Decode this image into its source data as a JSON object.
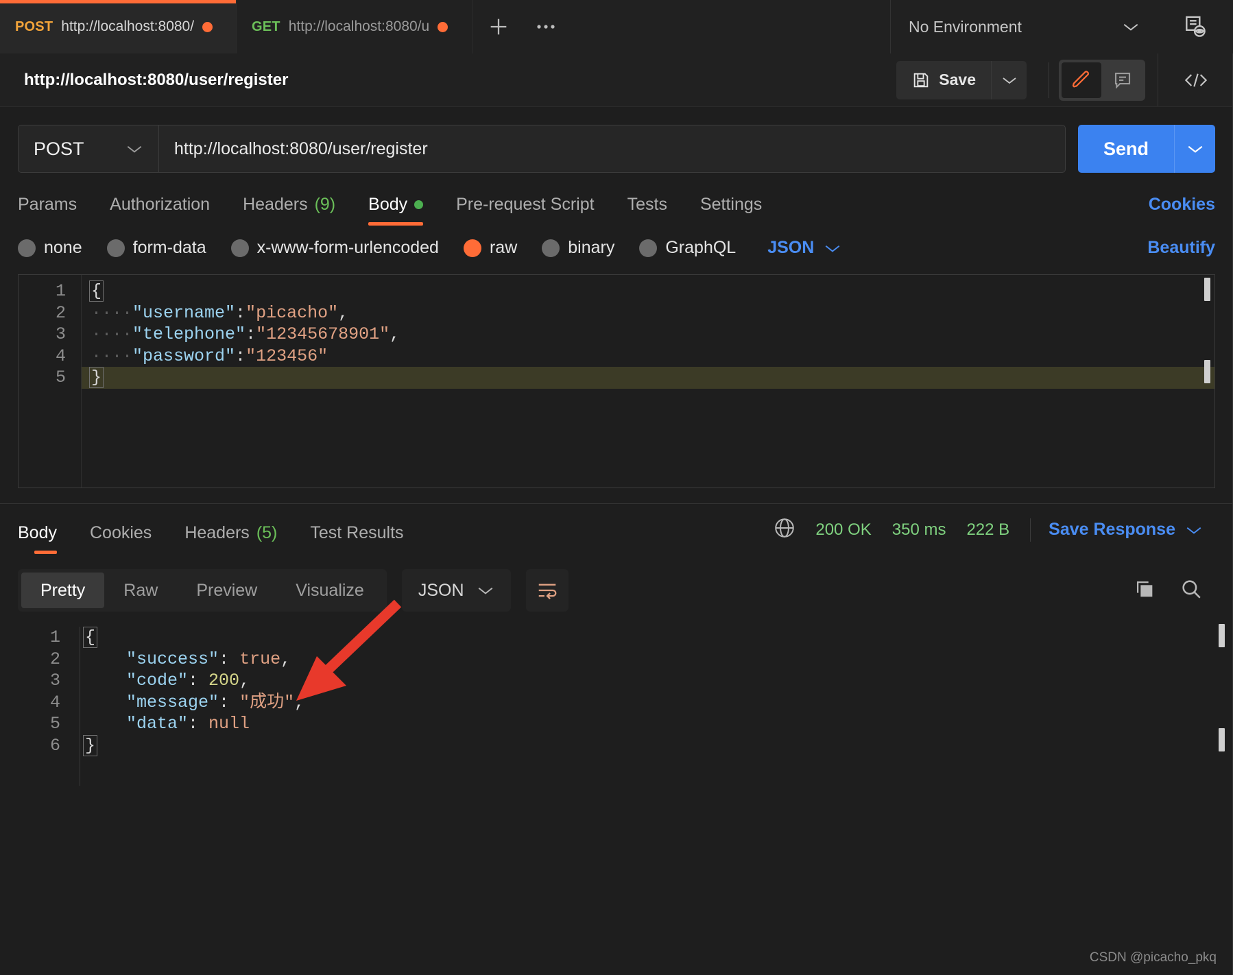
{
  "tabs": [
    {
      "method": "POST",
      "url": "http://localhost:8080/",
      "dirty": true,
      "active": true
    },
    {
      "method": "GET",
      "url": "http://localhost:8080/u",
      "dirty": true,
      "active": false
    }
  ],
  "tabbar": {
    "new_tab": "+",
    "more": "●●●",
    "environment": "No Environment"
  },
  "titlebar": {
    "request_title": "http://localhost:8080/user/register",
    "save_label": "Save"
  },
  "request": {
    "method": "POST",
    "url": "http://localhost:8080/user/register",
    "send_label": "Send"
  },
  "request_tabs": [
    {
      "label": "Params",
      "active": false
    },
    {
      "label": "Authorization",
      "active": false
    },
    {
      "label": "Headers",
      "count": "(9)",
      "active": false
    },
    {
      "label": "Body",
      "dot": true,
      "active": true
    },
    {
      "label": "Pre-request Script",
      "active": false
    },
    {
      "label": "Tests",
      "active": false
    },
    {
      "label": "Settings",
      "active": false
    }
  ],
  "links": {
    "cookies": "Cookies",
    "beautify": "Beautify"
  },
  "body_types": [
    {
      "label": "none",
      "selected": false
    },
    {
      "label": "form-data",
      "selected": false
    },
    {
      "label": "x-www-form-urlencoded",
      "selected": false
    },
    {
      "label": "raw",
      "selected": true
    },
    {
      "label": "binary",
      "selected": false
    },
    {
      "label": "GraphQL",
      "selected": false
    }
  ],
  "body_format": "JSON",
  "request_body": {
    "lines": [
      {
        "n": "1",
        "text": "{",
        "highlight": false
      },
      {
        "n": "2",
        "text": "····\"username\":\"picacho\",",
        "highlight": false
      },
      {
        "n": "3",
        "text": "····\"telephone\":\"12345678901\",",
        "highlight": false
      },
      {
        "n": "4",
        "text": "····\"password\":\"123456\"",
        "highlight": false
      },
      {
        "n": "5",
        "text": "}",
        "highlight": true
      }
    ]
  },
  "response_tabs": [
    {
      "label": "Body",
      "active": true
    },
    {
      "label": "Cookies",
      "active": false
    },
    {
      "label": "Headers",
      "count": "(5)",
      "active": false
    },
    {
      "label": "Test Results",
      "active": false
    }
  ],
  "response_meta": {
    "status": "200 OK",
    "time": "350 ms",
    "size": "222 B",
    "save_response": "Save Response"
  },
  "response_view_tabs": [
    {
      "label": "Pretty",
      "active": true
    },
    {
      "label": "Raw",
      "active": false
    },
    {
      "label": "Preview",
      "active": false
    },
    {
      "label": "Visualize",
      "active": false
    }
  ],
  "response_format": "JSON",
  "response_body": {
    "lines": [
      {
        "n": "1",
        "text": "{"
      },
      {
        "n": "2",
        "text": "    \"success\": true,"
      },
      {
        "n": "3",
        "text": "    \"code\": 200,"
      },
      {
        "n": "4",
        "text": "    \"message\": \"成功\","
      },
      {
        "n": "5",
        "text": "    \"data\": null"
      },
      {
        "n": "6",
        "text": "}"
      }
    ]
  },
  "watermark": "CSDN @picacho_pkq",
  "colors": {
    "accent": "#ff6c37",
    "link": "#4a8df3",
    "send": "#3b82f0",
    "status": "#7fd17f",
    "arrow": "#e8392b"
  }
}
